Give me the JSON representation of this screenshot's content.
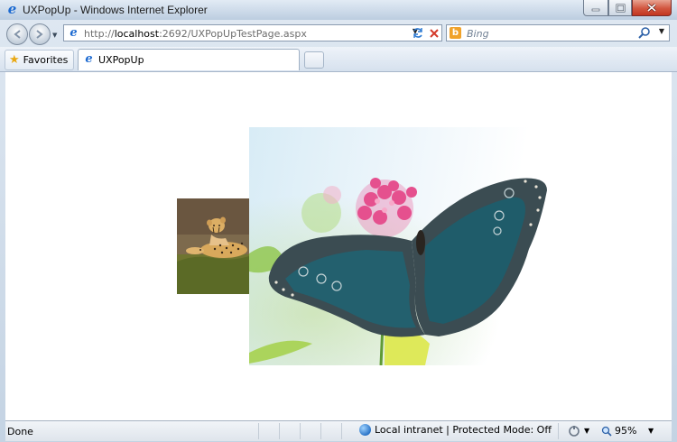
{
  "window": {
    "title": "UXPopUp - Windows Internet Explorer"
  },
  "address_bar": {
    "url_prefix": "http://",
    "url_host": "localhost",
    "url_rest": ":2692/UXPopUpTestPage.aspx"
  },
  "search": {
    "placeholder": "Bing"
  },
  "favorites": {
    "label": "Favorites"
  },
  "tabs": [
    {
      "label": "UXPopUp"
    }
  ],
  "status": {
    "text": "Done",
    "zone": "Local intranet | Protected Mode: Off",
    "zoom": "95%"
  },
  "icons": {
    "favorites": "star-icon",
    "zone": "globe-icon",
    "zoom": "magnifier-icon"
  }
}
